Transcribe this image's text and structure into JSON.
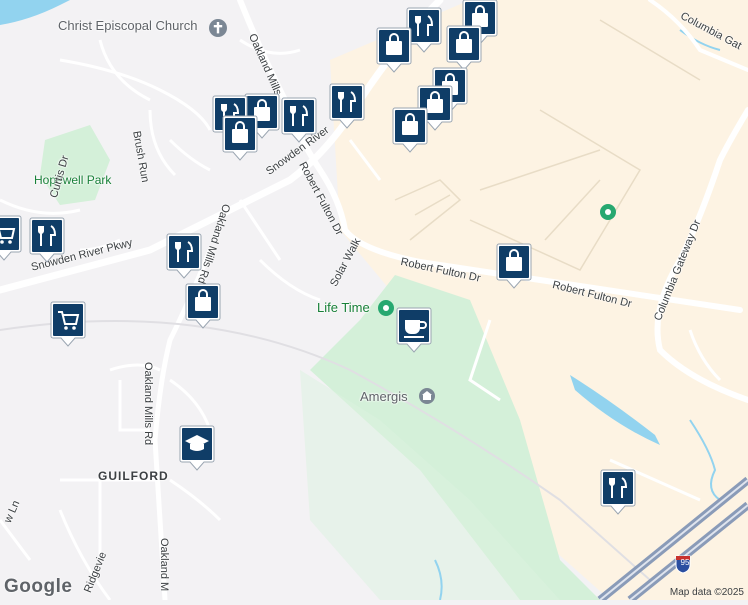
{
  "map": {
    "labels": {
      "church": "Christ Episcopal Church",
      "hopewell_park": "Hopewell Park",
      "brush_run": "Brush Run",
      "oakland_mills_top": "Oakland Mills",
      "snowden_river": "Snowden River",
      "snowden_river_pkwy": "Snowden River Pkwy",
      "oakland_mills_rd_mid": "Oakland Mills Rd",
      "oakland_mills_rd_low": "Oakland Mills Rd",
      "oakland_m_bottom": "Oakland M",
      "robert_fulton_dr_nw": "Robert Fulton Dr",
      "robert_fulton_dr_mid": "Robert Fulton Dr",
      "robert_fulton_dr_east": "Robert Fulton Dr",
      "solar_walk": "Solar Walk",
      "life_time": "Life Time",
      "amergis": "Amergis",
      "columbia_gateway_dr": "Columbia Gateway Dr",
      "columbia_gat": "Columbia Gat",
      "guilford": "GUILFORD",
      "curtis_dr": "Curtis Dr",
      "ridgeview": "Ridgevie",
      "ln_left": "w Ln",
      "interstate": "95"
    },
    "footer": {
      "brand": "Google",
      "copyright": "Map data ©2025"
    },
    "colors": {
      "background": "#f3f2f4",
      "commercial": "#fdf3e3",
      "park": "#d4f0d9",
      "water": "#92d3ef",
      "road": "#ffffff",
      "highway": "#8a9bb8",
      "marker": "#0f3d67"
    },
    "markers": [
      {
        "icon": "shopping-bag-icon"
      },
      {
        "icon": "restaurant-icon"
      },
      {
        "icon": "shopping-bag-icon"
      },
      {
        "icon": "shopping-bag-icon"
      },
      {
        "icon": "shopping-bag-icon"
      },
      {
        "icon": "shopping-bag-icon"
      },
      {
        "icon": "shopping-bag-icon"
      },
      {
        "icon": "restaurant-icon"
      },
      {
        "icon": "restaurant-icon"
      },
      {
        "icon": "shopping-bag-icon"
      },
      {
        "icon": "restaurant-icon"
      },
      {
        "icon": "shopping-bag-icon"
      },
      {
        "icon": "shopping-cart-icon"
      },
      {
        "icon": "restaurant-icon"
      },
      {
        "icon": "restaurant-icon"
      },
      {
        "icon": "shopping-bag-icon"
      },
      {
        "icon": "shopping-cart-icon"
      },
      {
        "icon": "coffee-icon"
      },
      {
        "icon": "shopping-bag-icon"
      },
      {
        "icon": "school-icon"
      },
      {
        "icon": "restaurant-icon"
      }
    ]
  }
}
